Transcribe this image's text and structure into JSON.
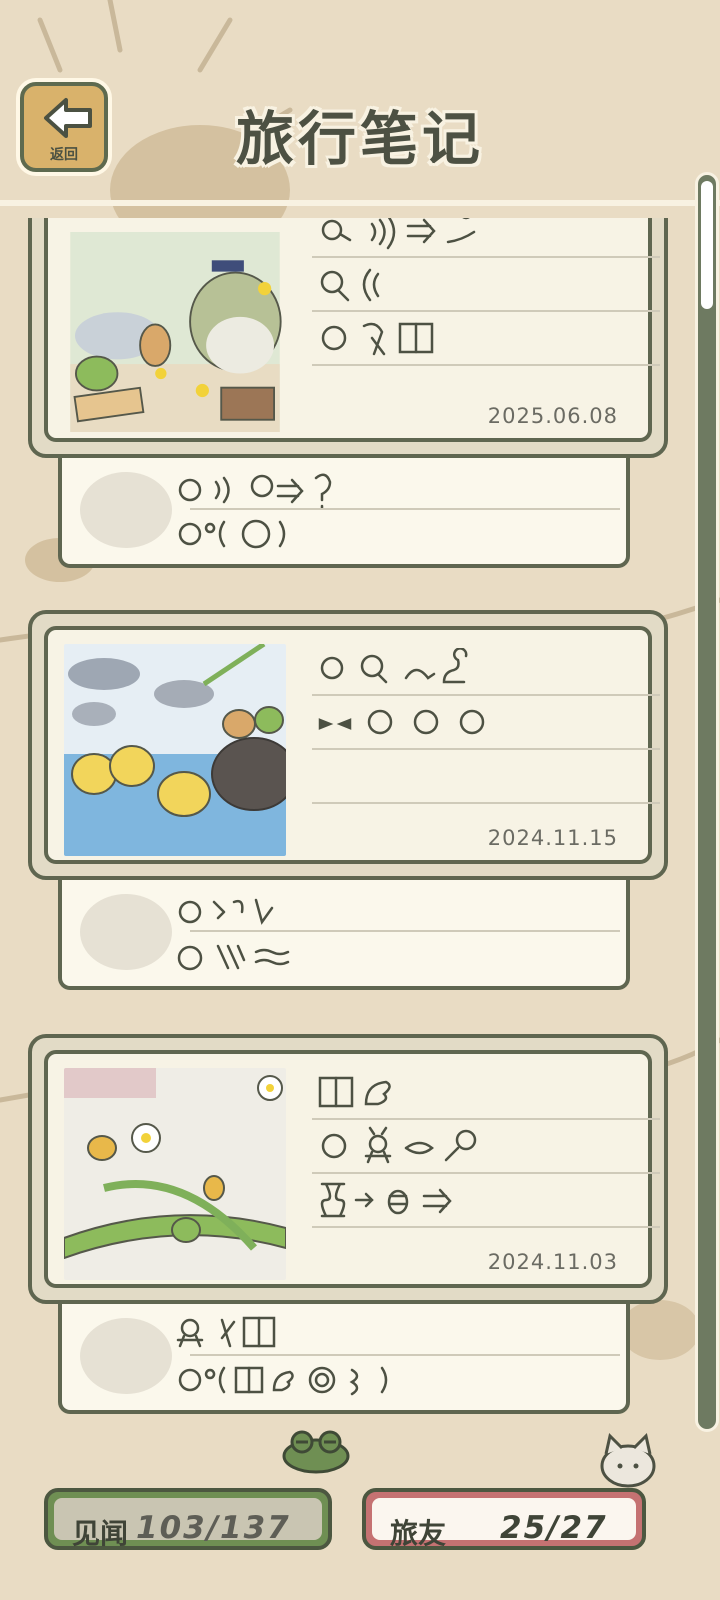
{
  "header": {
    "title": "旅行笔记",
    "back_label": "返回"
  },
  "entries": [
    {
      "date": "2025.06.08"
    },
    {
      "date": "2024.11.15"
    },
    {
      "date": "2024.11.03"
    }
  ],
  "footer": {
    "sights_label": "见闻",
    "sights_value": "103/137",
    "friends_label": "旅友",
    "friends_value": "25/27"
  },
  "colors": {
    "background": "#e9dcc4",
    "frame": "#5f6650",
    "card": "#f7f3e5",
    "green_pill": "#6f8f53",
    "pink_pill": "#c57272"
  }
}
